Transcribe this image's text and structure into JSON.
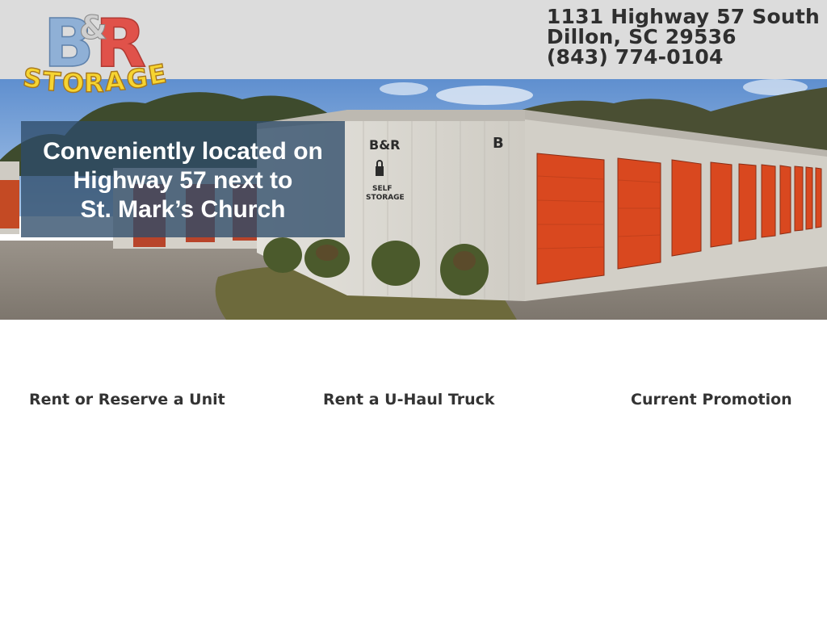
{
  "header": {
    "logo_text_top": "B&R",
    "logo_text_bottom": "STORAGE",
    "address_line1": "1131 Highway 57 South",
    "address_line2": "Dillon, SC 29536",
    "phone": "(843) 774-0104"
  },
  "hero": {
    "overlay_line1": "Conveniently located on",
    "overlay_line2": "Highway 57 next to",
    "overlay_line3": "St. Mark’s Church",
    "building_sign_brand": "B&R",
    "building_sign_text1": "SELF",
    "building_sign_text2": "STORAGE",
    "building_letter": "B"
  },
  "nav": {
    "rent_unit": "Rent or Reserve a Unit",
    "uhaul": "Rent a U-Haul Truck",
    "promotion": "Current Promotion"
  },
  "colors": {
    "header_bg": "#dcdcdc",
    "overlay_bg": "#2e4c69",
    "door_orange": "#d9481f",
    "link_text": "#333333"
  }
}
